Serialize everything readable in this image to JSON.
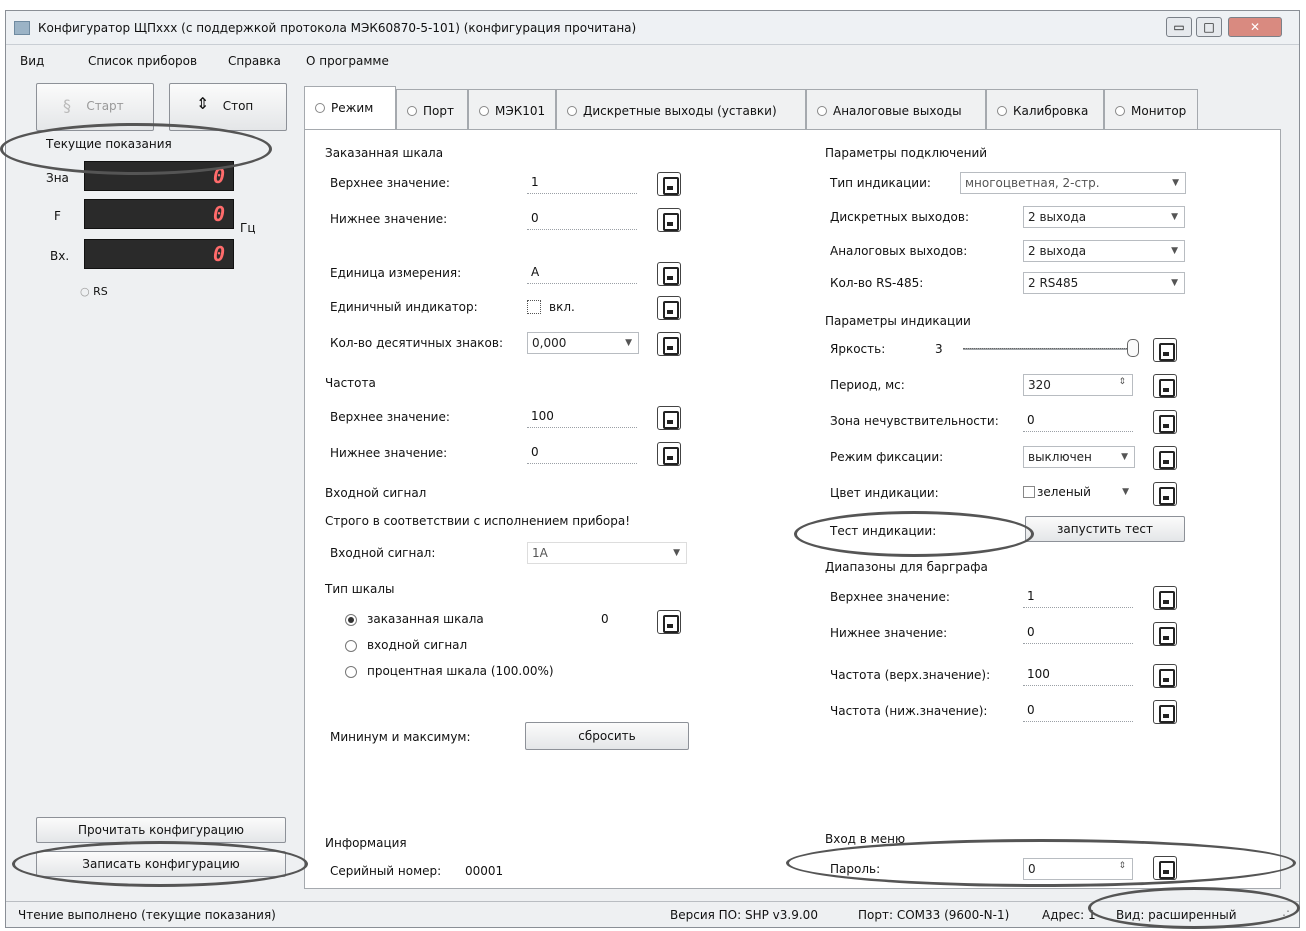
{
  "window": {
    "title": "Конфигуратор ЩПxxx (с поддержкой протокола МЭК60870-5-101) (конфигурация прочитана)"
  },
  "menu": [
    "Вид",
    "Список приборов",
    "Справка",
    "О программе"
  ],
  "left": {
    "start_label": "Старт",
    "stop_label": "Стоп",
    "readings_title": "Текущие показания",
    "rows": [
      {
        "label": "Зна",
        "value": "0",
        "unit": ""
      },
      {
        "label": "F",
        "value": "0",
        "unit": "Гц"
      },
      {
        "label": "Вх.",
        "value": "0",
        "unit": ""
      }
    ],
    "rs_label": "RS",
    "read_btn": "Прочитать конфигурацию",
    "write_btn": "Записать конфигурацию"
  },
  "tabs": [
    "Режим",
    "Порт",
    "МЭК101",
    "Дискретные выходы (уставки)",
    "Аналоговые выходы",
    "Калибровка",
    "Монитор"
  ],
  "mode": {
    "scale_title": "Заказанная шкала",
    "upper_label": "Верхнее значение:",
    "upper_value": "1",
    "lower_label": "Нижнее значение:",
    "lower_value": "0",
    "unit_label": "Единица измерения:",
    "unit_value": "A",
    "single_label": "Единичный индикатор:",
    "single_check": "вкл.",
    "decimals_label": "Кол-во десятичных знаков:",
    "decimals_value": "0,000",
    "freq_title": "Частота",
    "freq_upper_label": "Верхнее значение:",
    "freq_upper_value": "100",
    "freq_lower_label": "Нижнее значение:",
    "freq_lower_value": "0",
    "input_title": "Входной сигнал",
    "input_note": "Строго в соответствии с исполнением прибора!",
    "input_label": "Входной сигнал:",
    "input_value": "1A",
    "scale_type_title": "Тип шкалы",
    "scale_options": [
      "заказанная шкала",
      "входной сигнал",
      "процентная шкала (100.00%)"
    ],
    "scale_option_value": "0",
    "minmax_label": "Мининум и максимум:",
    "reset_btn": "сбросить",
    "info_title": "Информация",
    "serial_label": "Серийный номер:",
    "serial_value": "00001"
  },
  "conn": {
    "title": "Параметры подключений",
    "ind_type_label": "Тип индикации:",
    "ind_type_value": "многоцветная, 2-стр.",
    "discrete_label": "Дискретных выходов:",
    "discrete_value": "2 выхода",
    "analog_label": "Аналоговых выходов:",
    "analog_value": "2 выхода",
    "rs485_label": "Кол-во RS-485:",
    "rs485_value": "2 RS485"
  },
  "indication": {
    "title": "Параметры индикации",
    "brightness_label": "Яркость:",
    "brightness_value": "3",
    "period_label": "Период, мс:",
    "period_value": "320",
    "dead_label": "Зона нечувствительности:",
    "dead_value": "0",
    "fix_label": "Режим фиксации:",
    "fix_value": "выключен",
    "color_label": "Цвет индикации:",
    "color_value": "зеленый",
    "test_label": "Тест индикации:",
    "test_btn": "запустить тест"
  },
  "bargraph": {
    "title": "Диапазоны для барграфа",
    "upper_label": "Верхнее значение:",
    "upper_value": "1",
    "lower_label": "Нижнее значение:",
    "lower_value": "0",
    "fup_label": "Частота (верх.значение):",
    "fup_value": "100",
    "flow_label": "Частота (ниж.значение):",
    "flow_value": "0"
  },
  "menu_entry": {
    "title": "Вход в меню",
    "password_label": "Пароль:",
    "password_value": "0"
  },
  "status": {
    "left": "Чтение выполнено (текущие показания)",
    "version": "Версия ПО: SHP v3.9.00",
    "port": "Порт: COM33 (9600-N-1)",
    "addr": "Адрес: 1",
    "view": "Вид: расширенный"
  }
}
